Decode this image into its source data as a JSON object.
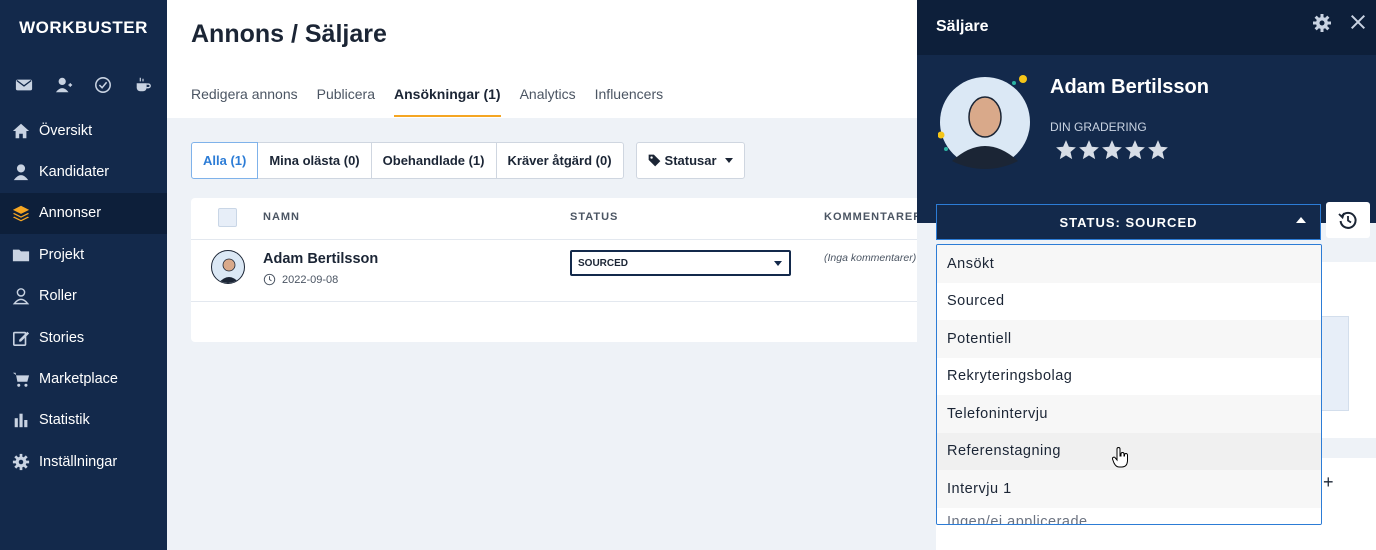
{
  "sidebar": {
    "brand": "WORKBUSTER",
    "quick_icons": [
      "mail-icon",
      "user-plus-icon",
      "check-circle-icon",
      "coffee-icon"
    ],
    "items": [
      {
        "label": "Översikt",
        "icon": "home-icon",
        "active": false
      },
      {
        "label": "Kandidater",
        "icon": "user-icon",
        "active": false
      },
      {
        "label": "Annonser",
        "icon": "layers-icon",
        "active": true
      },
      {
        "label": "Projekt",
        "icon": "folder-icon",
        "active": false
      },
      {
        "label": "Roller",
        "icon": "user-outline-icon",
        "active": false
      },
      {
        "label": "Stories",
        "icon": "edit-icon",
        "active": false
      },
      {
        "label": "Marketplace",
        "icon": "cart-icon",
        "active": false
      },
      {
        "label": "Statistik",
        "icon": "bar-chart-icon",
        "active": false
      },
      {
        "label": "Inställningar",
        "icon": "gear-icon",
        "active": false
      }
    ]
  },
  "main": {
    "title": "Annons / Säljare",
    "tabs": [
      {
        "label": "Redigera annons",
        "active": false
      },
      {
        "label": "Publicera",
        "active": false
      },
      {
        "label": "Ansökningar (1)",
        "active": true
      },
      {
        "label": "Analytics",
        "active": false
      },
      {
        "label": "Influencers",
        "active": false
      }
    ],
    "filters": [
      {
        "label": "Alla (1)",
        "active": true
      },
      {
        "label": "Mina olästa (0)",
        "active": false
      },
      {
        "label": "Obehandlade (1)",
        "active": false
      },
      {
        "label": "Kräver åtgärd (0)",
        "active": false
      }
    ],
    "status_filter_label": "Statusar",
    "table": {
      "columns": [
        "NAMN",
        "STATUS",
        "KOMMENTARER"
      ],
      "rows": [
        {
          "name": "Adam Bertilsson",
          "date": "2022-09-08",
          "status": "SOURCED",
          "comment": "(Inga kommentarer)"
        }
      ]
    }
  },
  "panel": {
    "title": "Säljare",
    "candidate_name": "Adam Bertilsson",
    "grade_label": "DIN GRADERING",
    "rating": 0,
    "max_rating": 5,
    "status_label": "STATUS: SOURCED",
    "status_options": [
      "Ansökt",
      "Sourced",
      "Potentiell",
      "Rekryteringsbolag",
      "Telefonintervju",
      "Referenstagning",
      "Intervju 1",
      "Ingen/ej applicerade"
    ],
    "hovered_option": "Referenstagning"
  },
  "colors": {
    "sidebar_bg": "#13294b",
    "accent": "#2c7cd6",
    "tab_underline": "#f5a623"
  }
}
